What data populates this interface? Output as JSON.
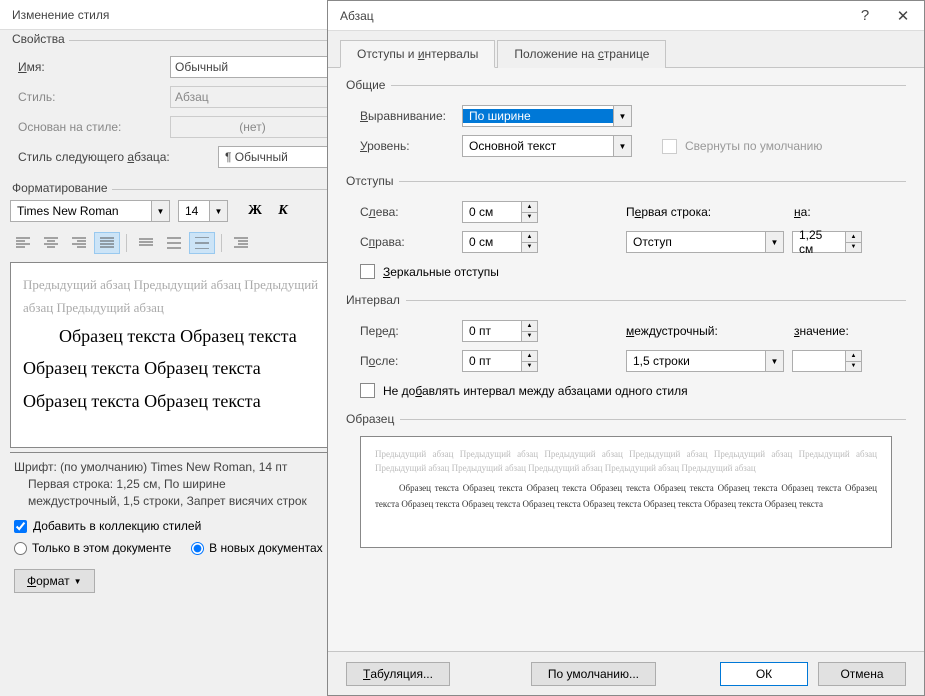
{
  "left": {
    "title": "Изменение стиля",
    "props_group": "Свойства",
    "name_label": "Имя:",
    "name_label_u": "И",
    "name_value": "Обычный",
    "style_label": "Стиль:",
    "style_value": "Абзац",
    "based_label": "Основан на стиле:",
    "based_value": "(нет)",
    "next_label": "Стиль следующего абзаца:",
    "next_label_u": "а",
    "next_value": "¶ Обычный",
    "fmt_group": "Форматирование",
    "font_name": "Times New Roman",
    "font_size": "14",
    "bold": "Ж",
    "italic": "К",
    "preview_prev": "Предыдущий абзац Предыдущий абзац Предыдущий абзац Предыдущий абзац",
    "preview_sample": "Образец текста Образец текста Образец текста Образец текста Образец текста Образец текста",
    "desc_line1": "Шрифт: (по умолчанию) Times New Roman, 14 пт",
    "desc_line2": "Первая строка:  1,25 см, По ширине",
    "desc_line3": "междустрочный,  1,5 строки, Запрет висячих строк",
    "add_collection": "Добавить в коллекцию стилей",
    "only_doc": "Только в этом документе",
    "new_docs": "В новых документах",
    "format_btn": "Формат",
    "format_btn_u": "Ф"
  },
  "right": {
    "title": "Абзац",
    "tab1": "Отступы и интервалы",
    "tab1_u": "и",
    "tab2": "Положение на странице",
    "tab2_u": "с",
    "general_group": "Общие",
    "align_label": "Выравнивание:",
    "align_label_u": "В",
    "align_value": "По ширине",
    "level_label": "Уровень:",
    "level_label_u": "У",
    "level_value": "Основной текст",
    "collapsed_label": "Свернуты по умолчанию",
    "indent_group": "Отступы",
    "left_label": "Слева:",
    "left_label_u": "л",
    "left_value": "0 см",
    "right_label": "Справа:",
    "right_label_u": "п",
    "right_value": "0 см",
    "first_line_label": "Первая строка:",
    "first_line_label_u": "е",
    "first_line_value": "Отступ",
    "by_label": "на:",
    "by_label_u": "н",
    "by_value": "1,25 см",
    "mirror_label": "Зеркальные отступы",
    "mirror_label_u": "З",
    "interval_group": "Интервал",
    "before_label": "Перед:",
    "before_label_u": "р",
    "before_value": "0 пт",
    "after_label": "После:",
    "after_label_u": "о",
    "after_value": "0 пт",
    "line_label": "междустрочный:",
    "line_label_u": "м",
    "line_value": "1,5 строки",
    "value_label": "значение:",
    "value_label_u": "з",
    "value_value": "",
    "noadd_label": "Не добавлять интервал между абзацами одного стиля",
    "noadd_label_u": "б",
    "sample_group": "Образец",
    "sample_prev": "Предыдущий абзац Предыдущий абзац Предыдущий абзац Предыдущий абзац Предыдущий абзац Предыдущий абзац Предыдущий абзац Предыдущий абзац Предыдущий абзац Предыдущий абзац Предыдущий абзац",
    "sample_main": "Образец текста Образец текста Образец текста Образец текста Образец текста Образец текста Образец текста Образец текста Образец текста Образец текста Образец текста Образец текста Образец текста Образец текста Образец текста",
    "tab_btn": "Табуляция...",
    "tab_btn_u": "Т",
    "default_btn": "По умолчанию...",
    "ok_btn": "ОК",
    "cancel_btn": "Отмена"
  }
}
